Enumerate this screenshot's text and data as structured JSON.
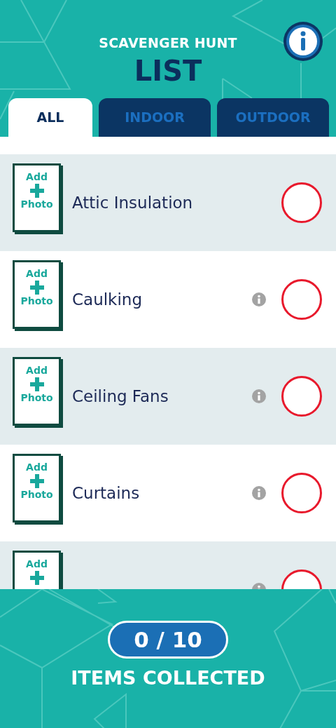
{
  "header": {
    "subtitle": "SCAVENGER HUNT",
    "title": "LIST"
  },
  "tabs": [
    {
      "label": "ALL",
      "selected": true
    },
    {
      "label": "INDOOR",
      "selected": false
    },
    {
      "label": "OUTDOOR",
      "selected": false
    }
  ],
  "items": [
    {
      "name": "Attic Insulation",
      "photo_label_top": "Add",
      "photo_label_bottom": "Photo",
      "info": false,
      "checked": false
    },
    {
      "name": "Caulking",
      "photo_label_top": "Add",
      "photo_label_bottom": "Photo",
      "info": true,
      "checked": false
    },
    {
      "name": "Ceiling Fans",
      "photo_label_top": "Add",
      "photo_label_bottom": "Photo",
      "info": true,
      "checked": false
    },
    {
      "name": "Curtains",
      "photo_label_top": "Add",
      "photo_label_bottom": "Photo",
      "info": true,
      "checked": false
    },
    {
      "photo_label_top": "Add",
      "info": true,
      "checked": false
    }
  ],
  "footer": {
    "count": "0 / 10",
    "caption": "ITEMS COLLECTED"
  }
}
